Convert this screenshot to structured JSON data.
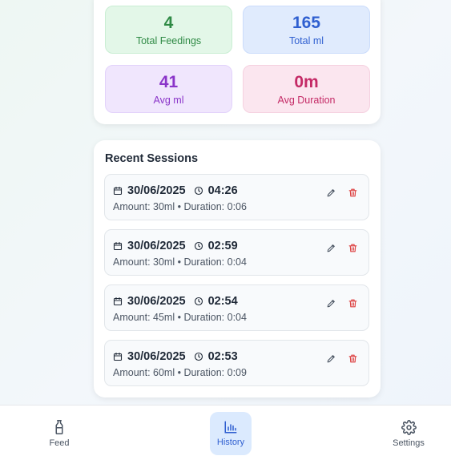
{
  "stats": [
    {
      "value": "4",
      "label": "Total Feedings",
      "color": "#2f8a45"
    },
    {
      "value": "165",
      "label": "Total ml",
      "color": "#2f5fd0"
    },
    {
      "value": "41",
      "label": "Avg ml",
      "color": "#8a34c9"
    },
    {
      "value": "0m",
      "label": "Avg Duration",
      "color": "#c42a66"
    }
  ],
  "recent": {
    "title": "Recent Sessions",
    "sessions": [
      {
        "date": "30/06/2025",
        "time": "04:26",
        "detail": "Amount: 30ml • Duration: 0:06"
      },
      {
        "date": "30/06/2025",
        "time": "02:59",
        "detail": "Amount: 30ml • Duration: 0:04"
      },
      {
        "date": "30/06/2025",
        "time": "02:54",
        "detail": "Amount: 45ml • Duration: 0:04"
      },
      {
        "date": "30/06/2025",
        "time": "02:53",
        "detail": "Amount: 60ml • Duration: 0:09"
      }
    ]
  },
  "nav": {
    "items": [
      {
        "label": "Feed",
        "icon": "bottle-icon"
      },
      {
        "label": "History",
        "icon": "bar-chart-icon",
        "active": true
      },
      {
        "label": "Settings",
        "icon": "gear-icon"
      }
    ]
  },
  "colors": {
    "accent": "#2f5fd0",
    "danger": "#dc3b3b"
  }
}
